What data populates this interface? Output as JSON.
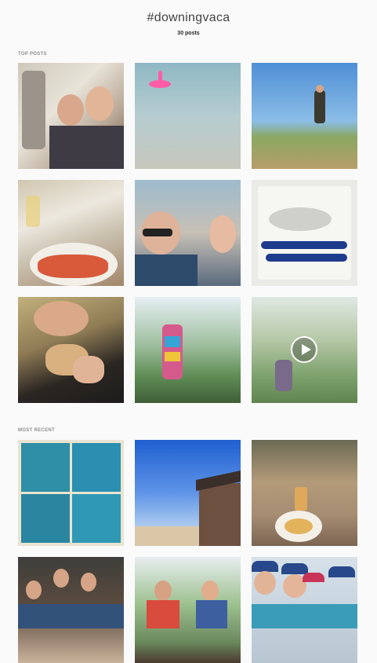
{
  "header": {
    "hashtag": "#downingvaca",
    "post_count": "30 posts"
  },
  "sections": {
    "top_posts_label": "TOP POSTS",
    "most_recent_label": "MOST RECENT"
  },
  "top_posts": [
    {
      "kind": "photo",
      "subject": "couple-selfie-airplane"
    },
    {
      "kind": "photo",
      "subject": "flamingo-float-water"
    },
    {
      "kind": "photo",
      "subject": "man-jumping-beach"
    },
    {
      "kind": "photo",
      "subject": "lobster-dinner-table"
    },
    {
      "kind": "photo",
      "subject": "group-selfie"
    },
    {
      "kind": "photo",
      "subject": "whale-plate"
    },
    {
      "kind": "photo",
      "subject": "man-eating-lobster-roll"
    },
    {
      "kind": "photo",
      "subject": "pinata-trees"
    },
    {
      "kind": "video",
      "subject": "pinata-swing-video"
    }
  ],
  "most_recent": [
    {
      "kind": "photo",
      "subject": "swimming-collage"
    },
    {
      "kind": "photo",
      "subject": "blue-sky-house"
    },
    {
      "kind": "photo",
      "subject": "pasta-dinner-group"
    },
    {
      "kind": "photo",
      "subject": "family-group-photo"
    },
    {
      "kind": "photo",
      "subject": "couple-house"
    },
    {
      "kind": "photo",
      "subject": "women-hats-selfie"
    }
  ],
  "colors": {
    "background": "#fafafa",
    "label_gray": "#8e8e8e",
    "text": "#262626"
  }
}
